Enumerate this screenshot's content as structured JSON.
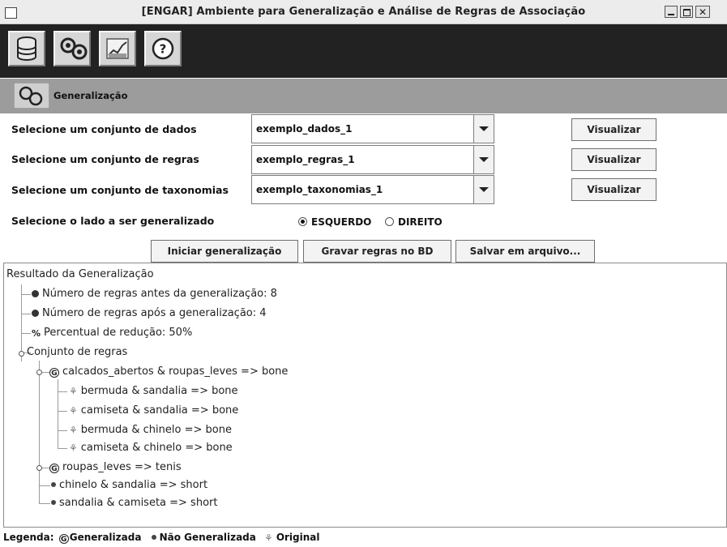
{
  "window": {
    "title": "[ENGAR] Ambiente para Generalização e Análise de Regras de Associação"
  },
  "toolbar": {
    "buttons": [
      {
        "icon": "database-icon"
      },
      {
        "icon": "gears-icon"
      },
      {
        "icon": "chart-icon"
      },
      {
        "icon": "help-icon"
      }
    ]
  },
  "section": {
    "title": "Generalização",
    "icon": "gears-icon"
  },
  "form": {
    "rows": [
      {
        "label": "Selecione um conjunto de dados",
        "value": "exemplo_dados_1",
        "button": "Visualizar"
      },
      {
        "label": "Selecione um conjunto de regras",
        "value": "exemplo_regras_1",
        "button": "Visualizar"
      },
      {
        "label": "Selecione um conjunto de taxonomias",
        "value": "exemplo_taxonomias_1",
        "button": "Visualizar"
      }
    ],
    "side_label": "Selecione o lado a ser generalizado",
    "side_options": [
      {
        "label": "ESQUERDO",
        "selected": true
      },
      {
        "label": "DIREITO",
        "selected": false
      }
    ]
  },
  "actions": {
    "start": "Iniciar generalização",
    "save_db": "Gravar regras no BD",
    "save_file": "Salvar em arquivo..."
  },
  "result": {
    "root": "Resultado da Generalização",
    "stats": [
      {
        "icon": "#",
        "text": "Número de regras antes da generalização: 8"
      },
      {
        "icon": "#",
        "text": "Número de regras após a generalização: 4"
      },
      {
        "icon": "%",
        "text": "Percentual de redução: 50%"
      }
    ],
    "ruleset_label": "Conjunto de regras",
    "rules": [
      {
        "type": "G",
        "text": "calcados_abertos & roupas_leves => bone",
        "expanded": true,
        "children": [
          "bermuda & sandalia => bone",
          "camiseta & sandalia => bone",
          "bermuda & chinelo => bone",
          "camiseta & chinelo => bone"
        ]
      },
      {
        "type": "G",
        "text": "roupas_leves => tenis",
        "expanded": false,
        "children": []
      },
      {
        "type": "N",
        "text": "chinelo & sandalia => short"
      },
      {
        "type": "N",
        "text": "sandalia & camiseta => short"
      }
    ]
  },
  "legend": {
    "prefix": "Legenda:",
    "generalized": "Generalizada",
    "not_generalized": "Não Generalizada",
    "original": "Original"
  }
}
